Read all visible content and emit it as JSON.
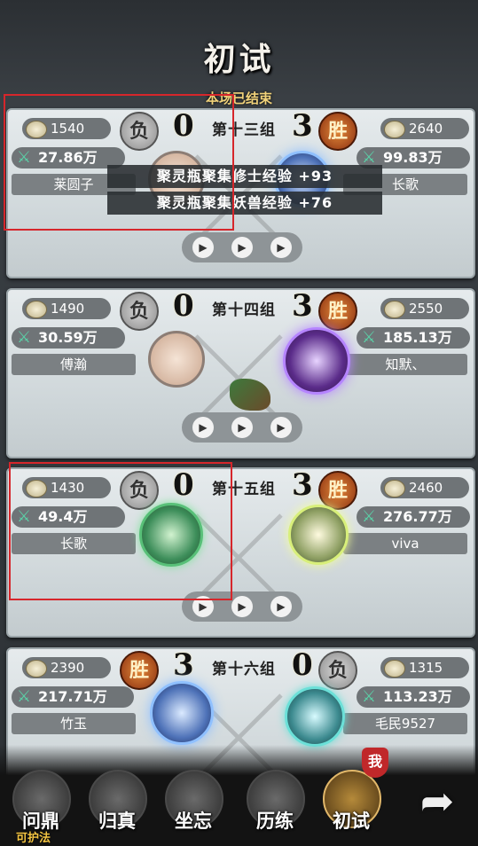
{
  "title": "初试",
  "status": "本场已结束",
  "matches": [
    {
      "group": "第十三组",
      "left": {
        "coins": "1540",
        "power": "27.86万",
        "name": "莱圆子",
        "result": "负",
        "score": "0"
      },
      "right": {
        "coins": "2640",
        "power": "99.83万",
        "name": "长歌",
        "result": "胜",
        "score": "3"
      }
    },
    {
      "group": "第十四组",
      "left": {
        "coins": "1490",
        "power": "30.59万",
        "name": "傅瀚",
        "result": "负",
        "score": "0"
      },
      "right": {
        "coins": "2550",
        "power": "185.13万",
        "name": "知默、",
        "result": "胜",
        "score": "3"
      }
    },
    {
      "group": "第十五组",
      "left": {
        "coins": "1430",
        "power": "49.4万",
        "name": "长歌",
        "result": "负",
        "score": "0"
      },
      "right": {
        "coins": "2460",
        "power": "276.77万",
        "name": "viva",
        "result": "胜",
        "score": "3"
      }
    },
    {
      "group": "第十六组",
      "left": {
        "coins": "2390",
        "power": "217.71万",
        "name": "竹玉",
        "result": "胜",
        "score": "3"
      },
      "right": {
        "coins": "1315",
        "power": "113.23万",
        "name": "毛民9527",
        "result": "负",
        "score": "0"
      }
    }
  ],
  "rewards": [
    "聚灵瓶聚集修士经验 +93",
    "聚灵瓶聚集妖兽经验 +76"
  ],
  "nav": {
    "items": [
      {
        "label": "问鼎",
        "sub": "可护法"
      },
      {
        "label": "归真"
      },
      {
        "label": "坐忘"
      },
      {
        "label": "历练"
      },
      {
        "label": "初试",
        "badge": "我"
      }
    ],
    "icons": [
      "shield-icon",
      "tower-icon",
      "lotus-icon",
      "pagoda-icon",
      "gold-pagoda-icon",
      "share-arrow-icon"
    ]
  }
}
